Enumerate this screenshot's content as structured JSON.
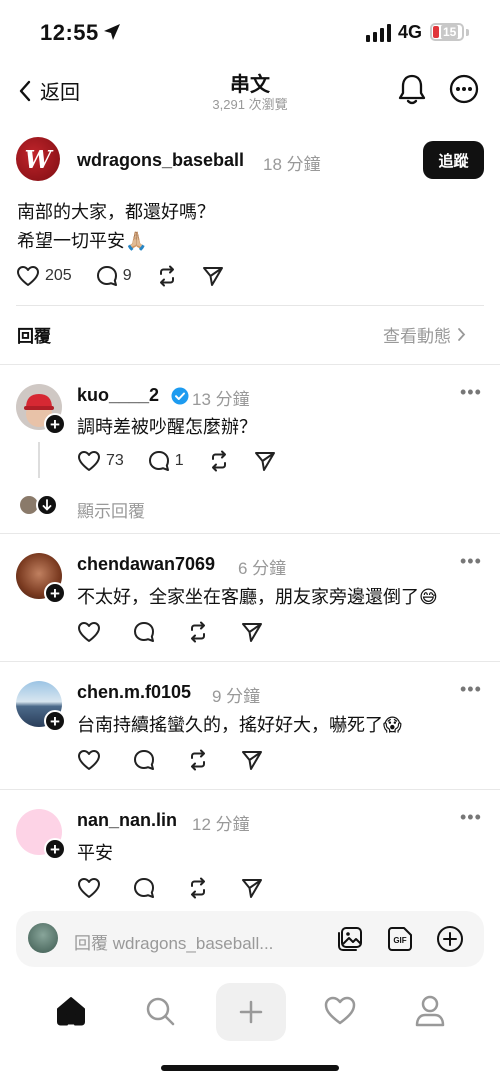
{
  "status": {
    "time": "12:55",
    "network": "4G",
    "battery": "15"
  },
  "nav": {
    "back_label": "返回",
    "title": "串文",
    "subtitle": "3,291 次瀏覽"
  },
  "post": {
    "username": "wdragons_baseball",
    "time": "18 分鐘",
    "follow_label": "追蹤",
    "line1": "南部的大家，都還好嗎？",
    "line2": "希望一切平安",
    "line2_emoji": "🙏🏼",
    "likes": "205",
    "comments": "9"
  },
  "replies_header": {
    "title": "回覆",
    "activity_label": "查看動態"
  },
  "comments": [
    {
      "username": "kuo____2",
      "time": "13 分鐘",
      "text": "調時差被吵醒怎麼辦？",
      "likes": "73",
      "replies": "1",
      "show_replies": "顯示回覆"
    },
    {
      "username": "chendawan7069",
      "time": "6 分鐘",
      "text": "不太好，全家坐在客廳，朋友家旁邊還倒了",
      "emoji": "😅"
    },
    {
      "username": "chen.m.f0105",
      "time": "9 分鐘",
      "text": "台南持續搖蠻久的，搖好好大，嚇死了",
      "emoji": "😱"
    },
    {
      "username": "nan_nan.lin",
      "time": "12 分鐘",
      "text": "平安"
    }
  ],
  "reply_bar": {
    "placeholder": "回覆 wdragons_baseball..."
  },
  "colors": {
    "verified": "#1d9bf0",
    "battery_low": "#e0363b",
    "muted": "#999999"
  },
  "icons": [
    "location-arrow-icon",
    "bell-icon",
    "more-icon",
    "heart-icon",
    "comment-icon",
    "repost-icon",
    "share-icon",
    "home-icon",
    "search-icon",
    "plus-icon",
    "activity-heart-icon",
    "profile-icon",
    "image-icon",
    "gif-icon",
    "add-circle-icon"
  ]
}
